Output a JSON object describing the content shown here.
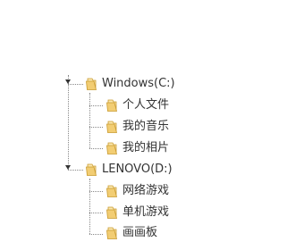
{
  "tree": {
    "drives": [
      {
        "label": "Windows(C:)",
        "icon": "folder-icon",
        "expanded": true,
        "children": [
          {
            "label": "个人文件",
            "icon": "folder-icon"
          },
          {
            "label": "我的音乐",
            "icon": "folder-icon"
          },
          {
            "label": "我的相片",
            "icon": "folder-icon"
          }
        ]
      },
      {
        "label": "LENOVO(D:)",
        "icon": "folder-icon",
        "expanded": true,
        "children": [
          {
            "label": "网络游戏",
            "icon": "folder-icon"
          },
          {
            "label": "单机游戏",
            "icon": "folder-icon"
          },
          {
            "label": "画画板",
            "icon": "folder-icon"
          }
        ]
      }
    ]
  },
  "colors": {
    "folder_fill": "#f2cd73",
    "folder_edge": "#c99a2e",
    "folder_light": "#fbe7ad",
    "connector": "#888888",
    "text": "#333333"
  }
}
